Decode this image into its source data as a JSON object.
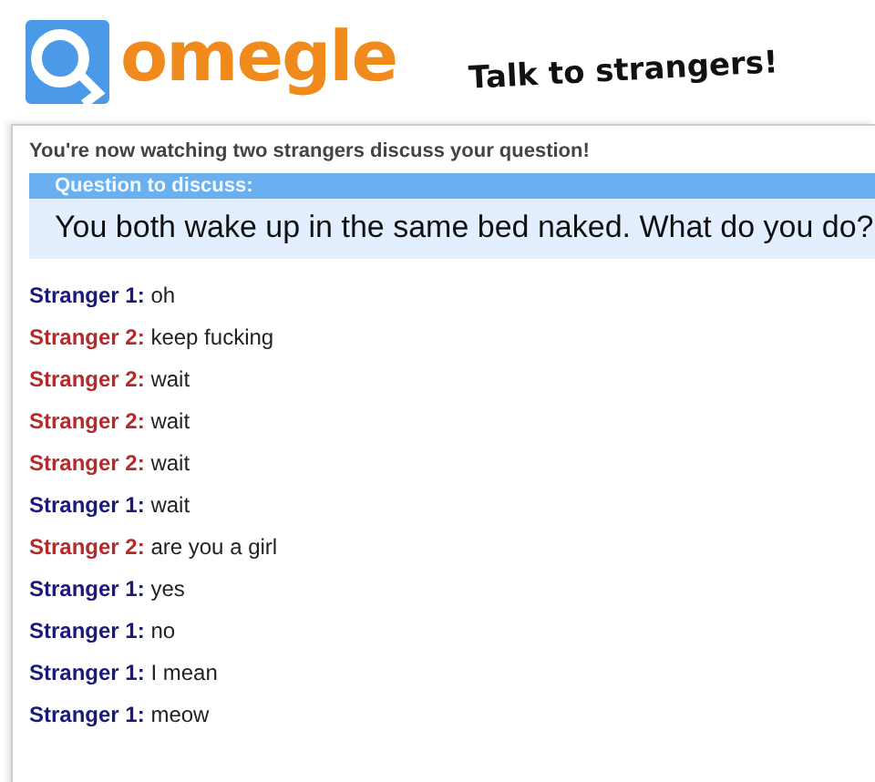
{
  "header": {
    "logo_text": "omegle",
    "tagline": "Talk to strangers!"
  },
  "status": "You're now watching two strangers discuss your question!",
  "question": {
    "heading": "Question to discuss:",
    "text": "You both wake up in the same bed naked. What do you do?"
  },
  "messages": [
    {
      "kind": "stranger1",
      "speaker": "Stranger 1:",
      "text": "oh"
    },
    {
      "kind": "stranger2",
      "speaker": "Stranger 2:",
      "text": "keep fucking"
    },
    {
      "kind": "stranger2",
      "speaker": "Stranger 2:",
      "text": "wait"
    },
    {
      "kind": "stranger2",
      "speaker": "Stranger 2:",
      "text": "wait"
    },
    {
      "kind": "stranger2",
      "speaker": "Stranger 2:",
      "text": "wait"
    },
    {
      "kind": "stranger1",
      "speaker": "Stranger 1:",
      "text": "wait"
    },
    {
      "kind": "stranger2",
      "speaker": "Stranger 2:",
      "text": "are you a girl"
    },
    {
      "kind": "stranger1",
      "speaker": "Stranger 1:",
      "text": "yes"
    },
    {
      "kind": "stranger1",
      "speaker": "Stranger 1:",
      "text": "no"
    },
    {
      "kind": "stranger1",
      "speaker": "Stranger 1:",
      "text": "I mean"
    },
    {
      "kind": "stranger1",
      "speaker": "Stranger 1:",
      "text": "meow"
    }
  ]
}
